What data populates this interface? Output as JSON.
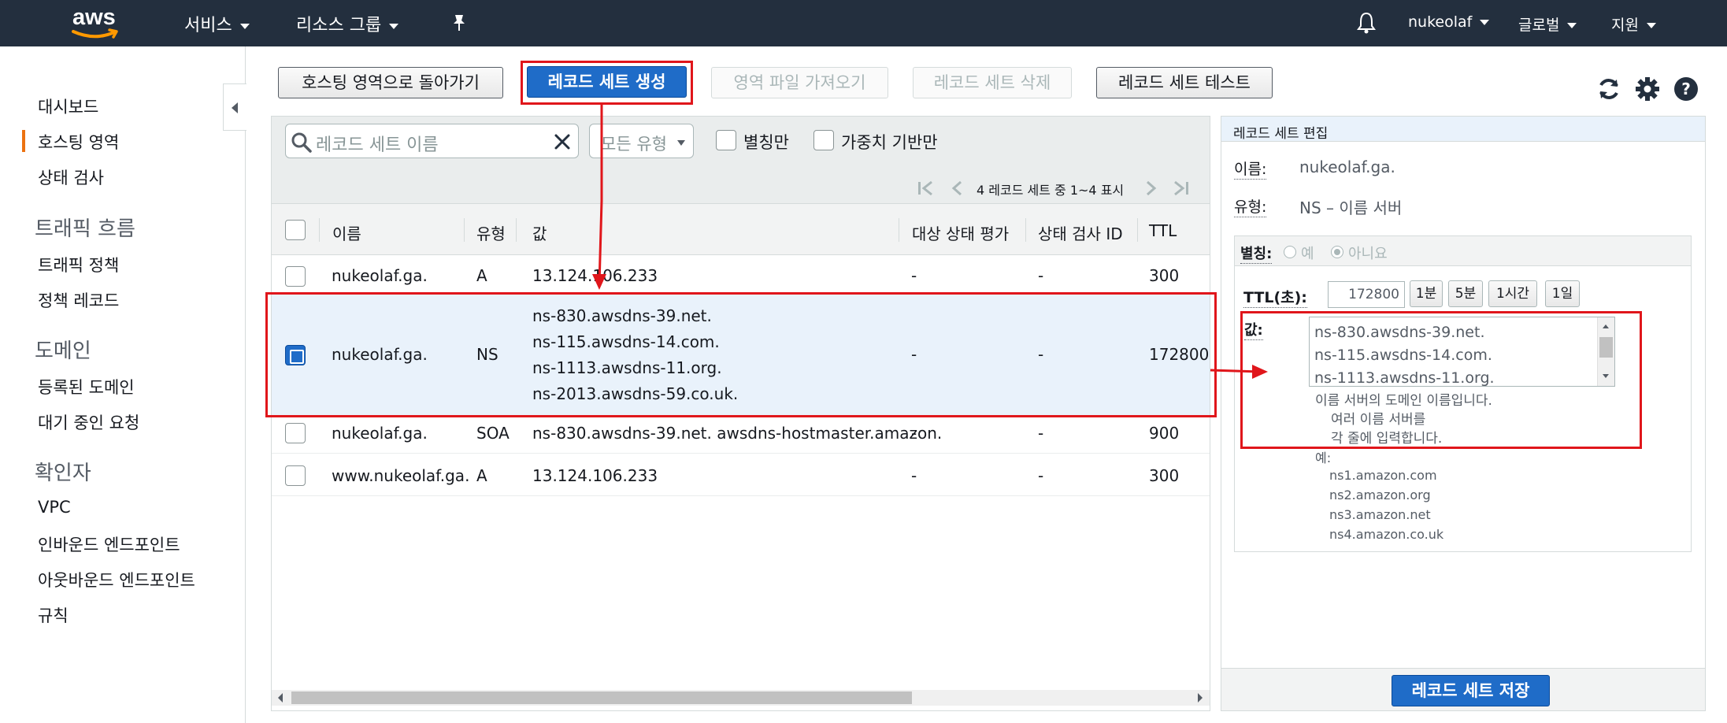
{
  "topnav": {
    "logo_text": "aws",
    "services": "서비스",
    "resource_groups": "리소스 그룹",
    "username": "nukeolaf",
    "region": "글로벌",
    "support": "지원"
  },
  "sidebar": {
    "items": [
      {
        "label": "대시보드"
      },
      {
        "label": "호스팅 영역",
        "active": true
      },
      {
        "label": "상태 검사"
      }
    ],
    "sections": [
      {
        "title": "트래픽 흐름",
        "items": [
          "트래픽 정책",
          "정책 레코드"
        ]
      },
      {
        "title": "도메인",
        "items": [
          "등록된 도메인",
          "대기 중인 요청"
        ]
      },
      {
        "title": "확인자",
        "items": [
          "VPC",
          "인바운드 엔드포인트",
          "아웃바운드 엔드포인트",
          "규칙"
        ]
      }
    ]
  },
  "toolbar": {
    "back_label": "호스팅 영역으로 돌아가기",
    "create_label": "레코드 세트 생성",
    "import_label": "영역 파일 가져오기",
    "delete_label": "레코드 세트 삭제",
    "test_label": "레코드 세트 테스트"
  },
  "filters": {
    "search_placeholder": "레코드 세트 이름",
    "type_value": "모든 유형",
    "alias_only": "별칭만",
    "weighted_only": "가중치 기반만"
  },
  "pager": {
    "text": "4 레코드 세트 중 1~4 표시"
  },
  "table": {
    "headers": {
      "name": "이름",
      "type": "유형",
      "value": "값",
      "eval": "대상 상태 평가",
      "health": "상태 검사 ID",
      "ttl": "TTL"
    },
    "rows": [
      {
        "name": "nukeolaf.ga.",
        "type": "A",
        "values": [
          "13.124.106.233"
        ],
        "eval": "-",
        "health": "-",
        "ttl": "300",
        "selected": false
      },
      {
        "name": "nukeolaf.ga.",
        "type": "NS",
        "values": [
          "ns-830.awsdns-39.net.",
          "ns-115.awsdns-14.com.",
          "ns-1113.awsdns-11.org.",
          "ns-2013.awsdns-59.co.uk."
        ],
        "eval": "-",
        "health": "-",
        "ttl": "172800",
        "selected": true
      },
      {
        "name": "nukeolaf.ga.",
        "type": "SOA",
        "values": [
          "ns-830.awsdns-39.net. awsdns-hostmaster.amazon."
        ],
        "eval": "-",
        "health": "-",
        "ttl": "900",
        "selected": false
      },
      {
        "name": "www.nukeolaf.ga.",
        "type": "A",
        "values": [
          "13.124.106.233"
        ],
        "eval": "-",
        "health": "-",
        "ttl": "300",
        "selected": false
      }
    ]
  },
  "editor": {
    "title": "레코드 세트 편집",
    "name_label": "이름:",
    "name_value": "nukeolaf.ga.",
    "type_label": "유형:",
    "type_value": "NS – 이름 서버",
    "alias_label": "별칭:",
    "alias_yes": "예",
    "alias_no": "아니요",
    "ttl_label": "TTL(초):",
    "ttl_value": "172800",
    "ttl_presets": [
      "1분",
      "5분",
      "1시간",
      "1일"
    ],
    "value_label": "값:",
    "value_lines": [
      "ns-830.awsdns-39.net.",
      "ns-115.awsdns-14.com.",
      "ns-1113.awsdns-11.org."
    ],
    "help_1": "이름 서버의 도메인 이름입니다.",
    "help_2": "여러 이름 서버를",
    "help_3": "각 줄에 입력합니다.",
    "example_label": "예:",
    "examples": [
      "ns1.amazon.com",
      "ns2.amazon.org",
      "ns3.amazon.net",
      "ns4.amazon.co.uk"
    ],
    "save_label": "레코드 세트 저장"
  },
  "colors": {
    "nav_bg": "#232f3e",
    "primary": "#1f6cc8",
    "annotation_red": "#e0161b",
    "accent_orange": "#ec7211"
  }
}
